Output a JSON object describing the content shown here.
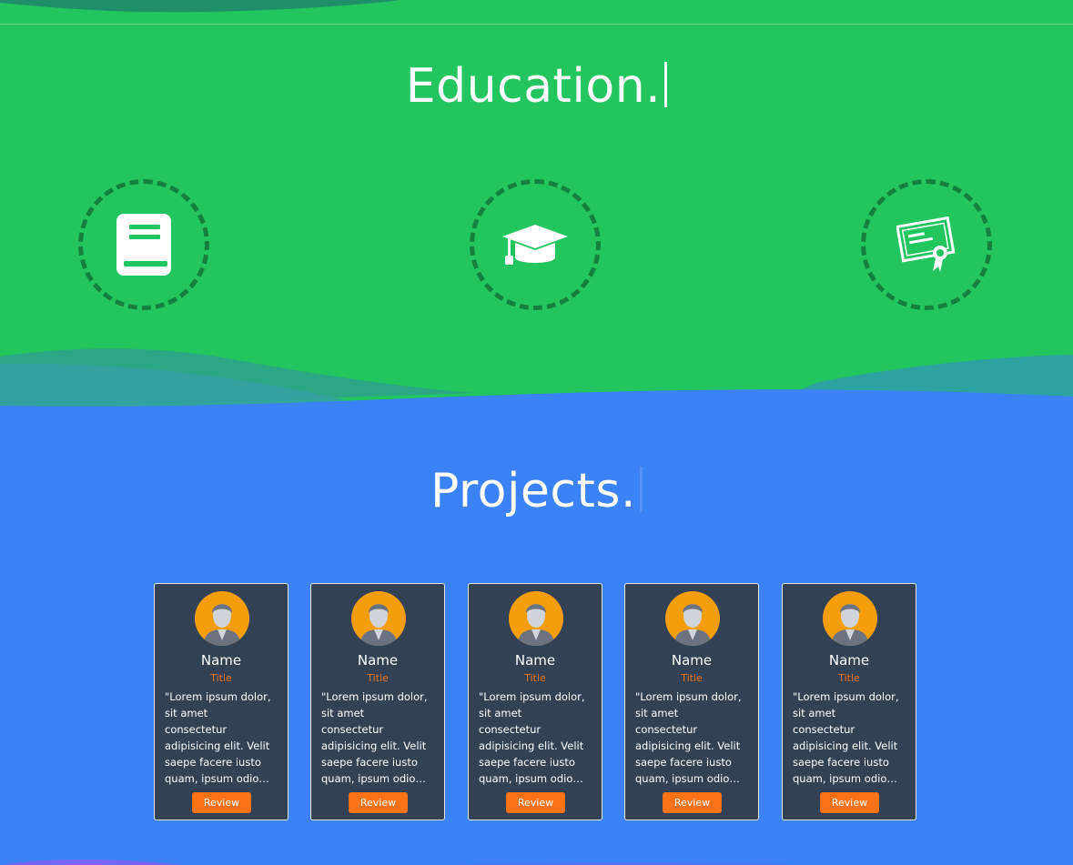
{
  "education": {
    "title": "Education.",
    "icons": [
      "book-icon",
      "graduation-cap-icon",
      "certificate-icon"
    ]
  },
  "projects": {
    "title": "Projects.",
    "cards": [
      {
        "name": "Name",
        "title": "Title",
        "quote": "\"Lorem ipsum dolor,\nsit amet\nconsectetur\nadipisicing elit. Velit\nsaepe facere iusto\nquam, ipsum odio…",
        "button": "Review"
      },
      {
        "name": "Name",
        "title": "Title",
        "quote": "\"Lorem ipsum dolor,\nsit amet\nconsectetur\nadipisicing elit. Velit\nsaepe facere iusto\nquam, ipsum odio…",
        "button": "Review"
      },
      {
        "name": "Name",
        "title": "Title",
        "quote": "\"Lorem ipsum dolor,\nsit amet\nconsectetur\nadipisicing elit. Velit\nsaepe facere iusto\nquam, ipsum odio…",
        "button": "Review"
      },
      {
        "name": "Name",
        "title": "Title",
        "quote": "\"Lorem ipsum dolor,\nsit amet\nconsectetur\nadipisicing elit. Velit\nsaepe facere iusto\nquam, ipsum odio…",
        "button": "Review"
      },
      {
        "name": "Name",
        "title": "Title",
        "quote": "\"Lorem ipsum dolor,\nsit amet\nconsectetur\nadipisicing elit. Velit\nsaepe facere iusto\nquam, ipsum odio…",
        "button": "Review"
      }
    ]
  },
  "colors": {
    "education_bg": "#22c55e",
    "projects_bg": "#3b82f6",
    "card_bg": "#334155",
    "accent": "#f97316",
    "avatar_bg": "#f59e0b",
    "icon_ring": "#15803d"
  }
}
